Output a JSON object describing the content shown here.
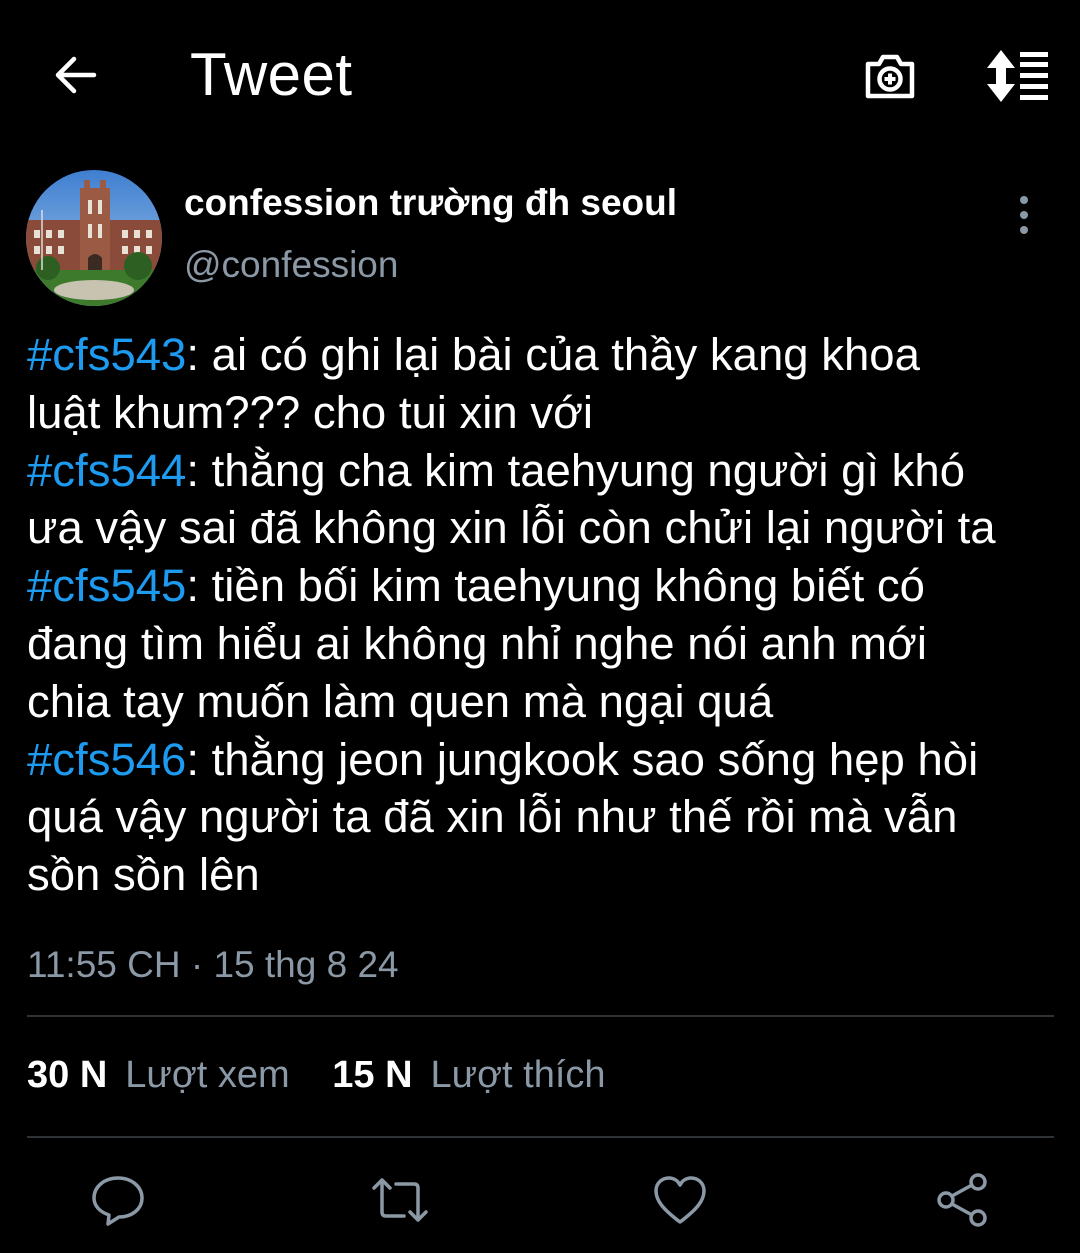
{
  "header": {
    "title": "Tweet",
    "back_icon": "arrow-left-icon",
    "camera_icon": "camera-plus-icon",
    "sort_icon": "sort-list-icon"
  },
  "author": {
    "name": "confession trường đh seoul",
    "handle": "@confession",
    "avatar": "building-photo"
  },
  "tweet": {
    "lines": [
      {
        "tag": "#cfs543",
        "text": ": ai có ghi lại bài của thầy kang khoa"
      },
      {
        "tag": "",
        "text": "luật khum??? cho tui xin với"
      },
      {
        "tag": "#cfs544",
        "text": ": thằng cha kim taehyung người gì khó"
      },
      {
        "tag": "",
        "text": "ưa vậy sai đã không xin lỗi còn chửi lại người ta"
      },
      {
        "tag": "#cfs545",
        "text": ": tiền bối kim taehyung không biết có"
      },
      {
        "tag": "",
        "text": "đang tìm hiểu ai không nhỉ nghe nói anh mới"
      },
      {
        "tag": "",
        "text": "chia tay muốn làm quen mà ngại quá"
      },
      {
        "tag": "#cfs546",
        "text": ": thằng jeon jungkook sao sống hẹp hòi"
      },
      {
        "tag": "",
        "text": "quá vậy người ta đã xin lỗi như thế rồi mà vẫn"
      },
      {
        "tag": "",
        "text": "sồn sồn lên"
      }
    ],
    "timestamp": "11:55 CH · 15 thg 8 24"
  },
  "stats": {
    "views_count": "30 N",
    "views_label": "Lượt xem",
    "likes_count": "15 N",
    "likes_label": "Lượt thích"
  },
  "actions": [
    "reply-icon",
    "retweet-icon",
    "like-icon",
    "share-icon"
  ],
  "colors": {
    "background": "#000000",
    "accent": "#1d9bf0",
    "muted": "#8b98a5",
    "divider": "#2f3336"
  }
}
